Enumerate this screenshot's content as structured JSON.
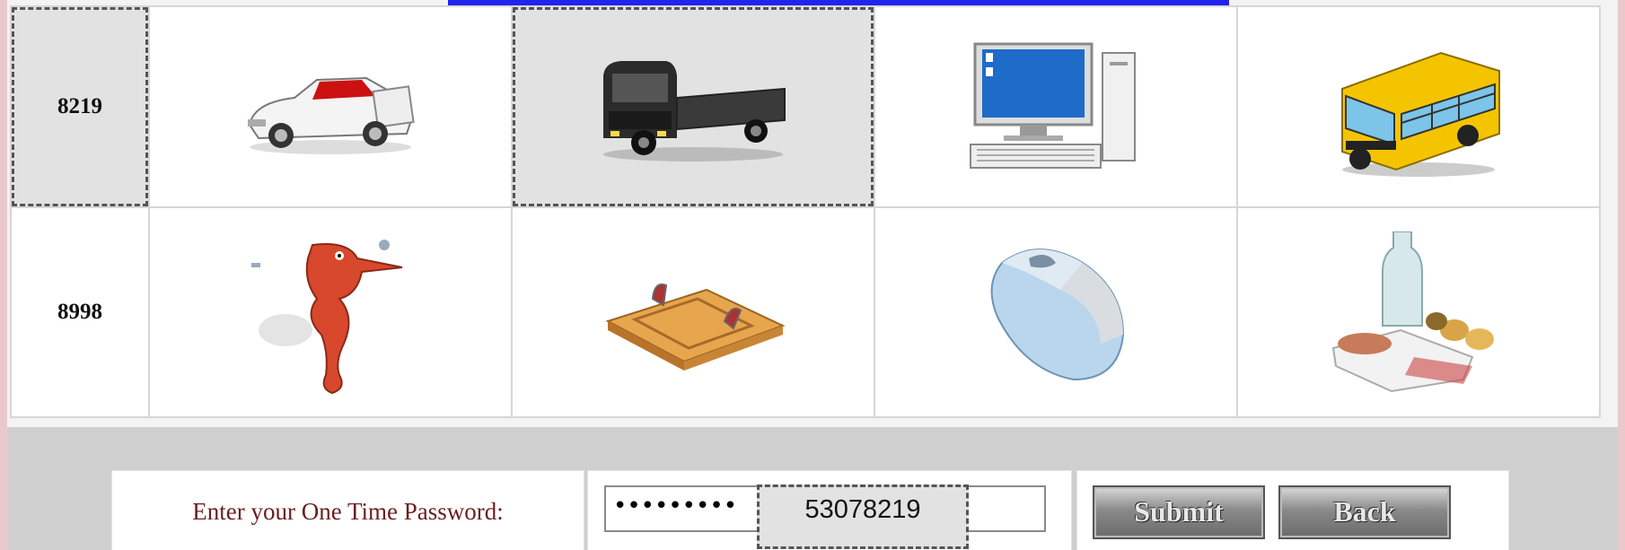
{
  "grid": {
    "rows": [
      {
        "number": "8219",
        "images": [
          "car-icon",
          "truck-icon",
          "computer-icon",
          "school-bus-icon"
        ],
        "selected_index": 1
      },
      {
        "number": "8998",
        "images": [
          "seahorse-icon",
          "mousetrap-icon",
          "computer-mouse-icon",
          "groceries-icon"
        ],
        "selected_index": -1
      }
    ]
  },
  "form": {
    "otp_label": "Enter your One Time Password:",
    "otp_masked_value": "•••••••••",
    "otp_hint": "53078219",
    "submit_label": "Submit",
    "back_label": "Back"
  },
  "colors": {
    "label_text": "#6b1e1e",
    "selection_fill": "#e2e2e2",
    "link_blue": "#2222ee"
  }
}
